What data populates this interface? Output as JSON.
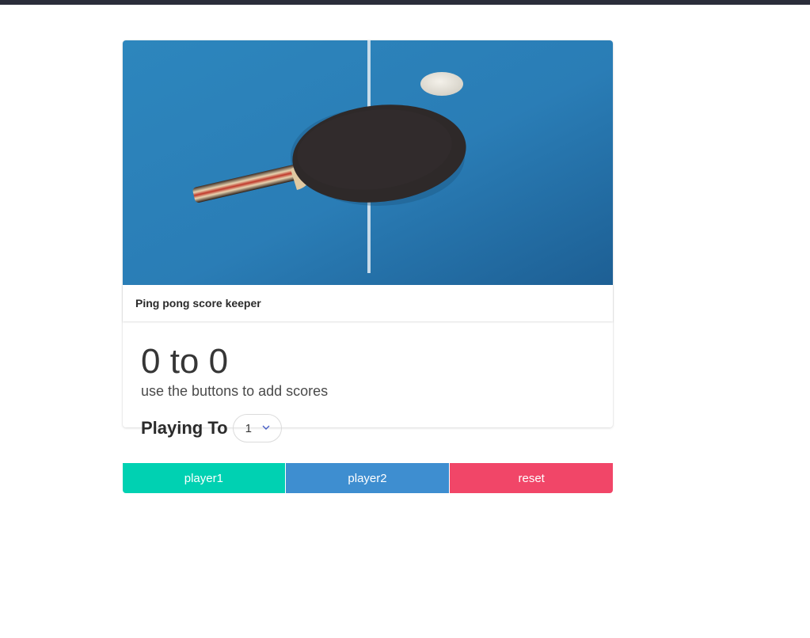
{
  "card": {
    "header_title": "Ping pong score keeper",
    "image_alt": "ping-pong-paddle-image"
  },
  "score": {
    "display": "0 to 0",
    "hint": "use the buttons to add scores"
  },
  "playing_to": {
    "label": "Playing To",
    "selected": "1"
  },
  "buttons": {
    "player1": "player1",
    "player2": "player2",
    "reset": "reset"
  },
  "colors": {
    "player1": "#00d1b2",
    "player2": "#3e8ed0",
    "reset": "#f14668",
    "table": "#2a7bb3"
  }
}
